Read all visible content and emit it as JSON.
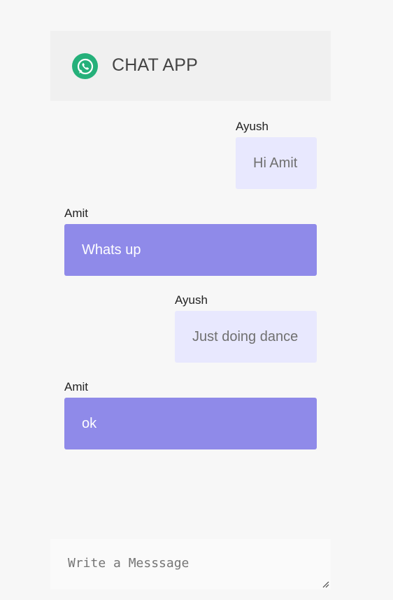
{
  "header": {
    "logo_icon": "whatsapp-icon",
    "title": "CHAT APP",
    "logo_color": "#25b07a"
  },
  "messages": [
    {
      "sender": "Ayush",
      "text": "Hi Amit",
      "side": "right"
    },
    {
      "sender": "Amit",
      "text": "Whats up",
      "side": "left"
    },
    {
      "sender": "Ayush",
      "text": "Just doing dance",
      "side": "right"
    },
    {
      "sender": "Amit",
      "text": "ok",
      "side": "left"
    }
  ],
  "composer": {
    "placeholder": "Write a Messsage",
    "value": ""
  },
  "colors": {
    "outgoing_bubble": "#e8e8fe",
    "incoming_bubble": "#8f8ae9",
    "header_bg": "#f0f0f0",
    "page_bg": "#f7f7f7"
  }
}
